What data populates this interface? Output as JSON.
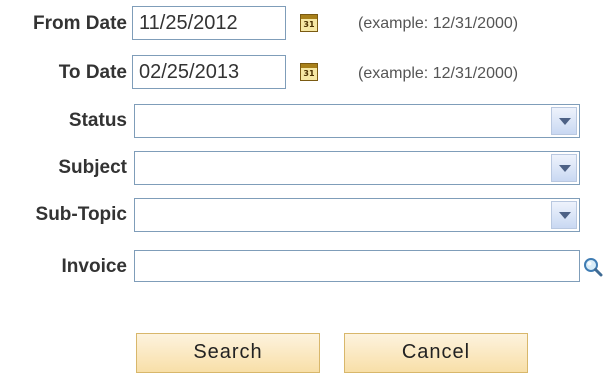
{
  "form": {
    "from_date": {
      "label": "From Date",
      "value": "11/25/2012",
      "example": "(example: 12/31/2000)"
    },
    "to_date": {
      "label": "To Date",
      "value": "02/25/2013",
      "example": "(example: 12/31/2000)"
    },
    "calendar_icon_text": "31",
    "status": {
      "label": "Status",
      "value": ""
    },
    "subject": {
      "label": "Subject",
      "value": ""
    },
    "sub_topic": {
      "label": "Sub-Topic",
      "value": ""
    },
    "invoice": {
      "label": "Invoice",
      "value": ""
    }
  },
  "buttons": {
    "search": "Search",
    "cancel": "Cancel"
  },
  "icons": {
    "calendar": "calendar-icon",
    "lookup": "magnifier-lookup-icon",
    "dropdown": "chevron-down-icon"
  }
}
